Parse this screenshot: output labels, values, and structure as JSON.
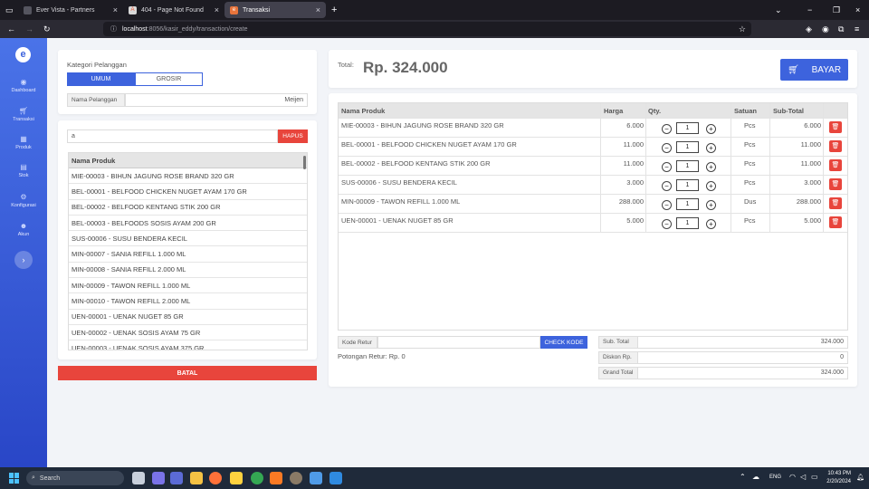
{
  "browser": {
    "tabs": [
      {
        "label": "Ever Vista - Partners",
        "active": false
      },
      {
        "label": "404 - Page Not Found",
        "active": false
      },
      {
        "label": "Transaksi",
        "active": true
      }
    ],
    "url_host": "localhost",
    "url_rest": ":8056/kasir_eddy/transaction/create"
  },
  "sidebar": {
    "brand": "e",
    "items": [
      {
        "label": "Dashboard",
        "icon": "dashboard-icon"
      },
      {
        "label": "Transaksi",
        "icon": "cart-icon"
      },
      {
        "label": "Produk",
        "icon": "cubes-icon"
      },
      {
        "label": "Stok",
        "icon": "boxes-icon"
      },
      {
        "label": "Konfigurasi",
        "icon": "gears-icon"
      },
      {
        "label": "Akun",
        "icon": "users-icon"
      }
    ]
  },
  "customer": {
    "kategori_label": "Kategori Pelanggan",
    "options": [
      "UMUM",
      "GROSIR"
    ],
    "selected": "UMUM",
    "nama_label": "Nama Pelanggan",
    "nama_value": "Meijen"
  },
  "search": {
    "value": "a",
    "clear_label": "HAPUS"
  },
  "product_list": {
    "header": "Nama Produk",
    "items": [
      "MIE-00003 - BIHUN JAGUNG ROSE BRAND 320 GR",
      "BEL-00001 - BELFOOD CHICKEN NUGET AYAM 170 GR",
      "BEL-00002 - BELFOOD KENTANG STIK 200 GR",
      "BEL-00003 - BELFOODS SOSIS AYAM 200 GR",
      "SUS-00006 - SUSU BENDERA KECIL",
      "MIN-00007 - SANIA REFILL 1.000 ML",
      "MIN-00008 - SANIA REFILL 2.000 ML",
      "MIN-00009 - TAWON REFILL 1.000 ML",
      "MIN-00010 - TAWON REFILL 2.000 ML",
      "UEN-00001 - UENAK NUGET 85 GR",
      "UEN-00002 - UENAK SOSIS AYAM 75 GR",
      "UEN-00003 - UENAK SOSIS AYAM 375 GR"
    ]
  },
  "cancel_label": "BATAL",
  "total": {
    "label": "Total:",
    "value": "Rp. 324.000",
    "pay_label": "BAYAR"
  },
  "cart": {
    "headers": [
      "Nama Produk",
      "Harga",
      "Qty.",
      "Satuan",
      "Sub-Total"
    ],
    "rows": [
      {
        "name": "MIE-00003 - BIHUN JAGUNG ROSE BRAND 320 GR",
        "price": "6.000",
        "qty": "1",
        "unit": "Pcs",
        "subtotal": "6.000"
      },
      {
        "name": "BEL-00001 - BELFOOD CHICKEN NUGET AYAM 170 GR",
        "price": "11.000",
        "qty": "1",
        "unit": "Pcs",
        "subtotal": "11.000"
      },
      {
        "name": "BEL-00002 - BELFOOD KENTANG STIK 200 GR",
        "price": "11.000",
        "qty": "1",
        "unit": "Pcs",
        "subtotal": "11.000"
      },
      {
        "name": "SUS-00006 - SUSU BENDERA KECIL",
        "price": "3.000",
        "qty": "1",
        "unit": "Pcs",
        "subtotal": "3.000"
      },
      {
        "name": "MIN-00009 - TAWON REFILL 1.000 ML",
        "price": "288.000",
        "qty": "1",
        "unit": "Dus",
        "subtotal": "288.000"
      },
      {
        "name": "UEN-00001 - UENAK NUGET 85 GR",
        "price": "5.000",
        "qty": "1",
        "unit": "Pcs",
        "subtotal": "5.000"
      }
    ],
    "minus": "−",
    "plus": "+"
  },
  "retur": {
    "label": "Kode Retur",
    "value": "",
    "check_label": "CHECK KODE",
    "potongan": "Potongan Retur: Rp. 0"
  },
  "summary": {
    "sub_total_label": "Sub. Total",
    "sub_total": "324.000",
    "diskon_label": "Diskon Rp.",
    "diskon": "0",
    "grand_total_label": "Grand Total",
    "grand_total": "324.000"
  },
  "taskbar": {
    "search_placeholder": "Search",
    "lang": "ENG",
    "time": "10:43 PM",
    "date": "2/20/2024"
  }
}
